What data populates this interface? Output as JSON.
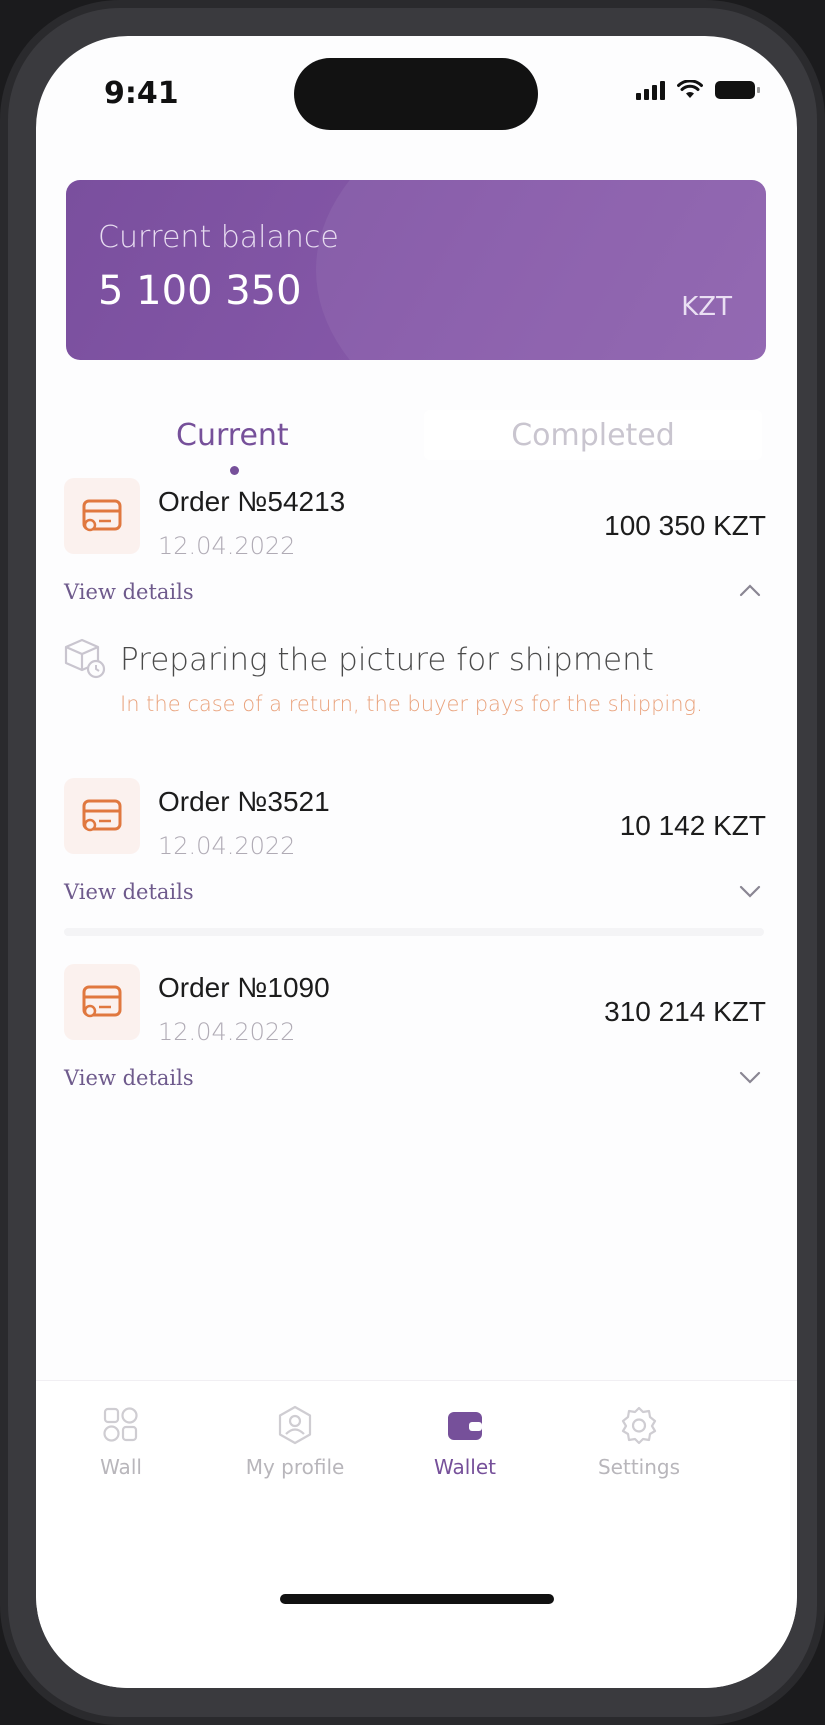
{
  "status_bar": {
    "time": "9:41"
  },
  "balance": {
    "label": "Current balance",
    "amount": "5 100 350",
    "currency": "KZT"
  },
  "tabs": {
    "current": "Current",
    "completed": "Completed"
  },
  "orders": [
    {
      "title": "Order №54213",
      "date": "12.04.2022",
      "amount": "100 350 KZT",
      "details_label": "View details",
      "expanded": true
    },
    {
      "title": "Order №3521",
      "date": "12.04.2022",
      "amount": "10 142 KZT",
      "details_label": "View details",
      "expanded": false
    },
    {
      "title": "Order №1090",
      "date": "12.04.2022",
      "amount": "310 214 KZT",
      "details_label": "View details",
      "expanded": false
    }
  ],
  "shipment": {
    "title": "Preparing the picture for shipment",
    "note": "In the case of a return, the buyer pays for the shipping."
  },
  "nav": [
    {
      "label": "Wall",
      "icon": "grid-icon",
      "active": false
    },
    {
      "label": "My profile",
      "icon": "profile-icon",
      "active": false
    },
    {
      "label": "Wallet",
      "icon": "wallet-icon",
      "active": true
    },
    {
      "label": "Settings",
      "icon": "gear-icon",
      "active": false
    }
  ],
  "colors": {
    "accent": "#76509a",
    "card": "#8558a8",
    "warning_text": "#e9a27c",
    "order_icon": "#e0783f"
  }
}
